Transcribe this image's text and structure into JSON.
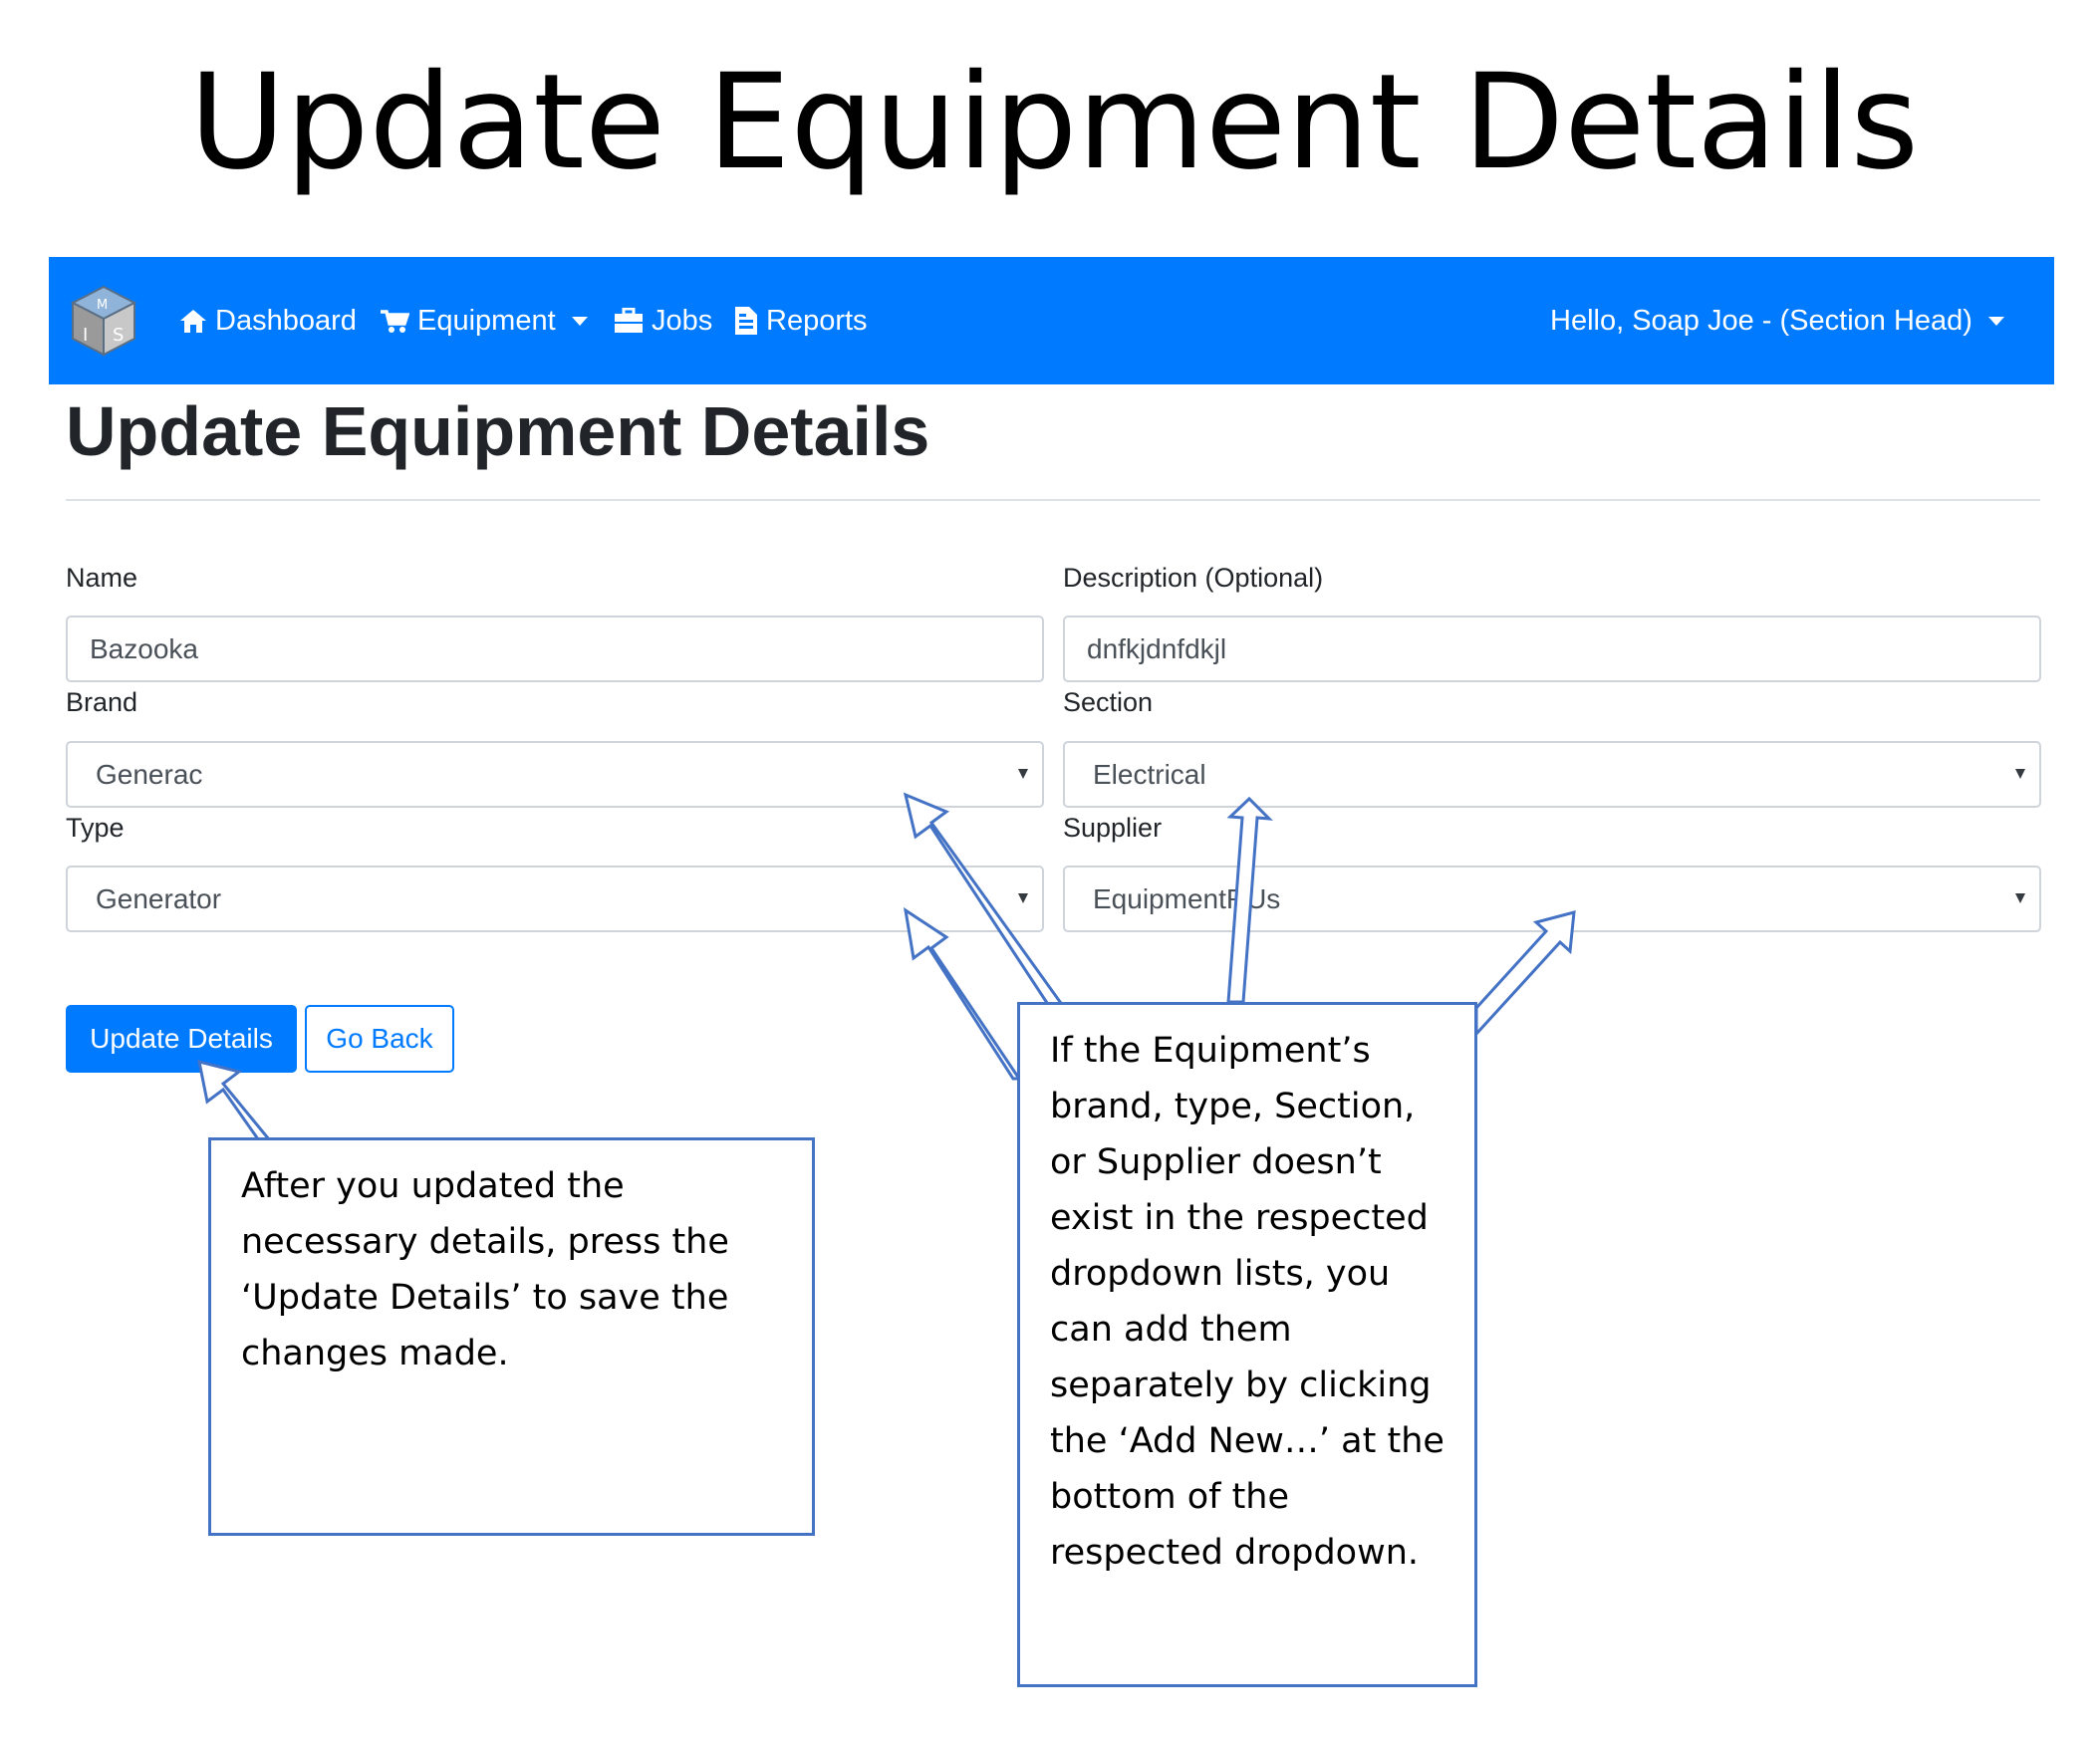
{
  "slide_title": "Update Equipment Details",
  "navbar": {
    "brand_logo_text": "MIS",
    "items": [
      {
        "label": "Dashboard",
        "icon": "home-icon"
      },
      {
        "label": "Equipment",
        "icon": "cart-icon",
        "dropdown": true
      },
      {
        "label": "Jobs",
        "icon": "briefcase-icon"
      },
      {
        "label": "Reports",
        "icon": "document-icon"
      }
    ],
    "user_menu": "Hello, Soap Joe - (Section Head)",
    "bg_color": "#007bff"
  },
  "page": {
    "heading": "Update Equipment Details"
  },
  "form": {
    "name": {
      "label": "Name",
      "value": "Bazooka"
    },
    "description": {
      "label": "Description (Optional)",
      "value": "dnfkjdnfdkjl"
    },
    "brand": {
      "label": "Brand",
      "value": "Generac"
    },
    "section": {
      "label": "Section",
      "value": "Electrical"
    },
    "type": {
      "label": "Type",
      "value": "Generator"
    },
    "supplier": {
      "label": "Supplier",
      "value": "EquipmentRUs"
    }
  },
  "buttons": {
    "update": "Update Details",
    "back": "Go Back"
  },
  "callouts": {
    "update_note": "After you updated the necessary details, press the ‘Update Details’ to save the changes made.",
    "dropdown_note": "If the Equipment’s brand, type, Section, or Supplier doesn’t exist in the respected dropdown lists, you can add them separately by clicking the ‘Add New…’ at the bottom of the respected dropdown."
  },
  "colors": {
    "primary": "#007bff",
    "callout_border": "#4472c4"
  }
}
